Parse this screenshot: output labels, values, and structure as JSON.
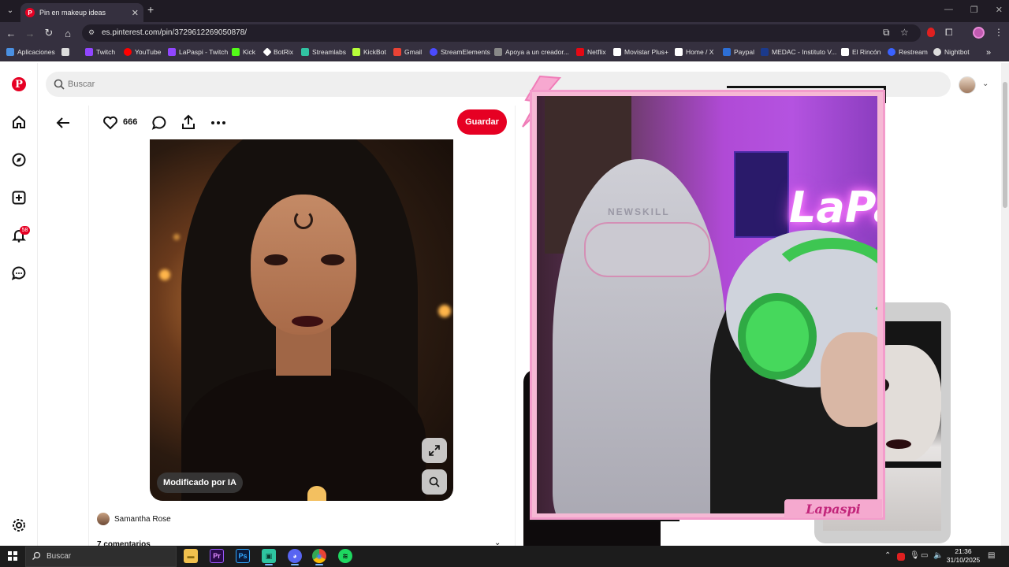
{
  "browser": {
    "tab_title": "Pin en makeup ideas",
    "tab_close": "✕",
    "new_tab": "+",
    "tab_list": "⌄",
    "url": "es.pinterest.com/pin/3729612269050878/",
    "window_controls": [
      "—",
      "❐",
      "✕"
    ]
  },
  "bookmarks": [
    {
      "label": "Aplicaciones",
      "color": "#4a90e2"
    },
    {
      "label": "",
      "color": "#dddddd"
    },
    {
      "label": "Twitch",
      "color": "#9146ff"
    },
    {
      "label": "YouTube",
      "color": "#ff0000"
    },
    {
      "label": "LaPaspi - Twitch",
      "color": "#9146ff"
    },
    {
      "label": "Kick",
      "color": "#53fc18"
    },
    {
      "label": "BotRix",
      "color": "#ffffff"
    },
    {
      "label": "Streamlabs",
      "color": "#31c3a2"
    },
    {
      "label": "KickBot",
      "color": "#b8ff3a"
    },
    {
      "label": "Gmail",
      "color": "#ea4335"
    },
    {
      "label": "StreamElements",
      "color": "#4b4bff"
    },
    {
      "label": "Apoya a un creador...",
      "color": "#888888"
    },
    {
      "label": "Netflix",
      "color": "#e50914"
    },
    {
      "label": "Movistar Plus+",
      "color": "#ffffff"
    },
    {
      "label": "Home / X",
      "color": "#ffffff"
    },
    {
      "label": "Paypal",
      "color": "#2d6fd6"
    },
    {
      "label": "MEDAC - Instituto V...",
      "color": "#1b3a8c"
    },
    {
      "label": "El Rincón",
      "color": "#ffffff"
    },
    {
      "label": "Restream",
      "color": "#3a62ff"
    },
    {
      "label": "Nightbot",
      "color": "#dddddd"
    },
    {
      "label": "»",
      "color": ""
    }
  ],
  "pinterest": {
    "search_placeholder": "Buscar",
    "notification_count": "58",
    "like_count": "666",
    "save_label": "Guardar",
    "ai_badge": "Modificado por IA",
    "author_name": "Samantha Rose",
    "comments_label": "7 comentarios",
    "comments_chevron": "⌄"
  },
  "stream": {
    "nameplate": "Lapaspi",
    "chair_brand": "NEWSKILL",
    "neon_sign": "LaPa"
  },
  "taskbar": {
    "search_placeholder": "Buscar",
    "apps": [
      {
        "name": "file-explorer",
        "glyph": "▬",
        "color": "#f2c14e"
      },
      {
        "name": "premiere",
        "glyph": "Pr",
        "color": "#2a0a4a"
      },
      {
        "name": "photoshop",
        "glyph": "Ps",
        "color": "#0a1a3a"
      },
      {
        "name": "streamlabs",
        "glyph": "▣",
        "color": "#2ec4a0"
      },
      {
        "name": "discord",
        "glyph": "◕",
        "color": "#5865f2"
      },
      {
        "name": "chrome",
        "glyph": "◉",
        "color": "#e8b21a"
      },
      {
        "name": "spotify",
        "glyph": "≋",
        "color": "#1ed760"
      }
    ],
    "time": "21:36",
    "date": "31/10/2025"
  }
}
